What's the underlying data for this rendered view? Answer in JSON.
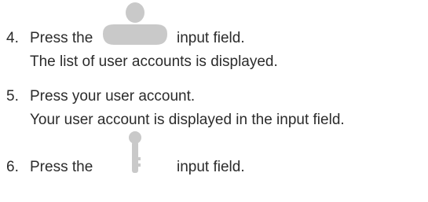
{
  "steps": [
    {
      "number": "4.",
      "text_before": "Press the",
      "icon": "user-icon",
      "text_after": "input field.",
      "result": "The list of user accounts is displayed."
    },
    {
      "number": "5.",
      "text": "Press your user account.",
      "result": "Your user account is displayed in the input field."
    },
    {
      "number": "6.",
      "text_before": "Press the",
      "icon": "key-icon",
      "text_after": "input field."
    }
  ],
  "colors": {
    "text": "#2b2b2b",
    "icon": "#c9c9c9"
  }
}
